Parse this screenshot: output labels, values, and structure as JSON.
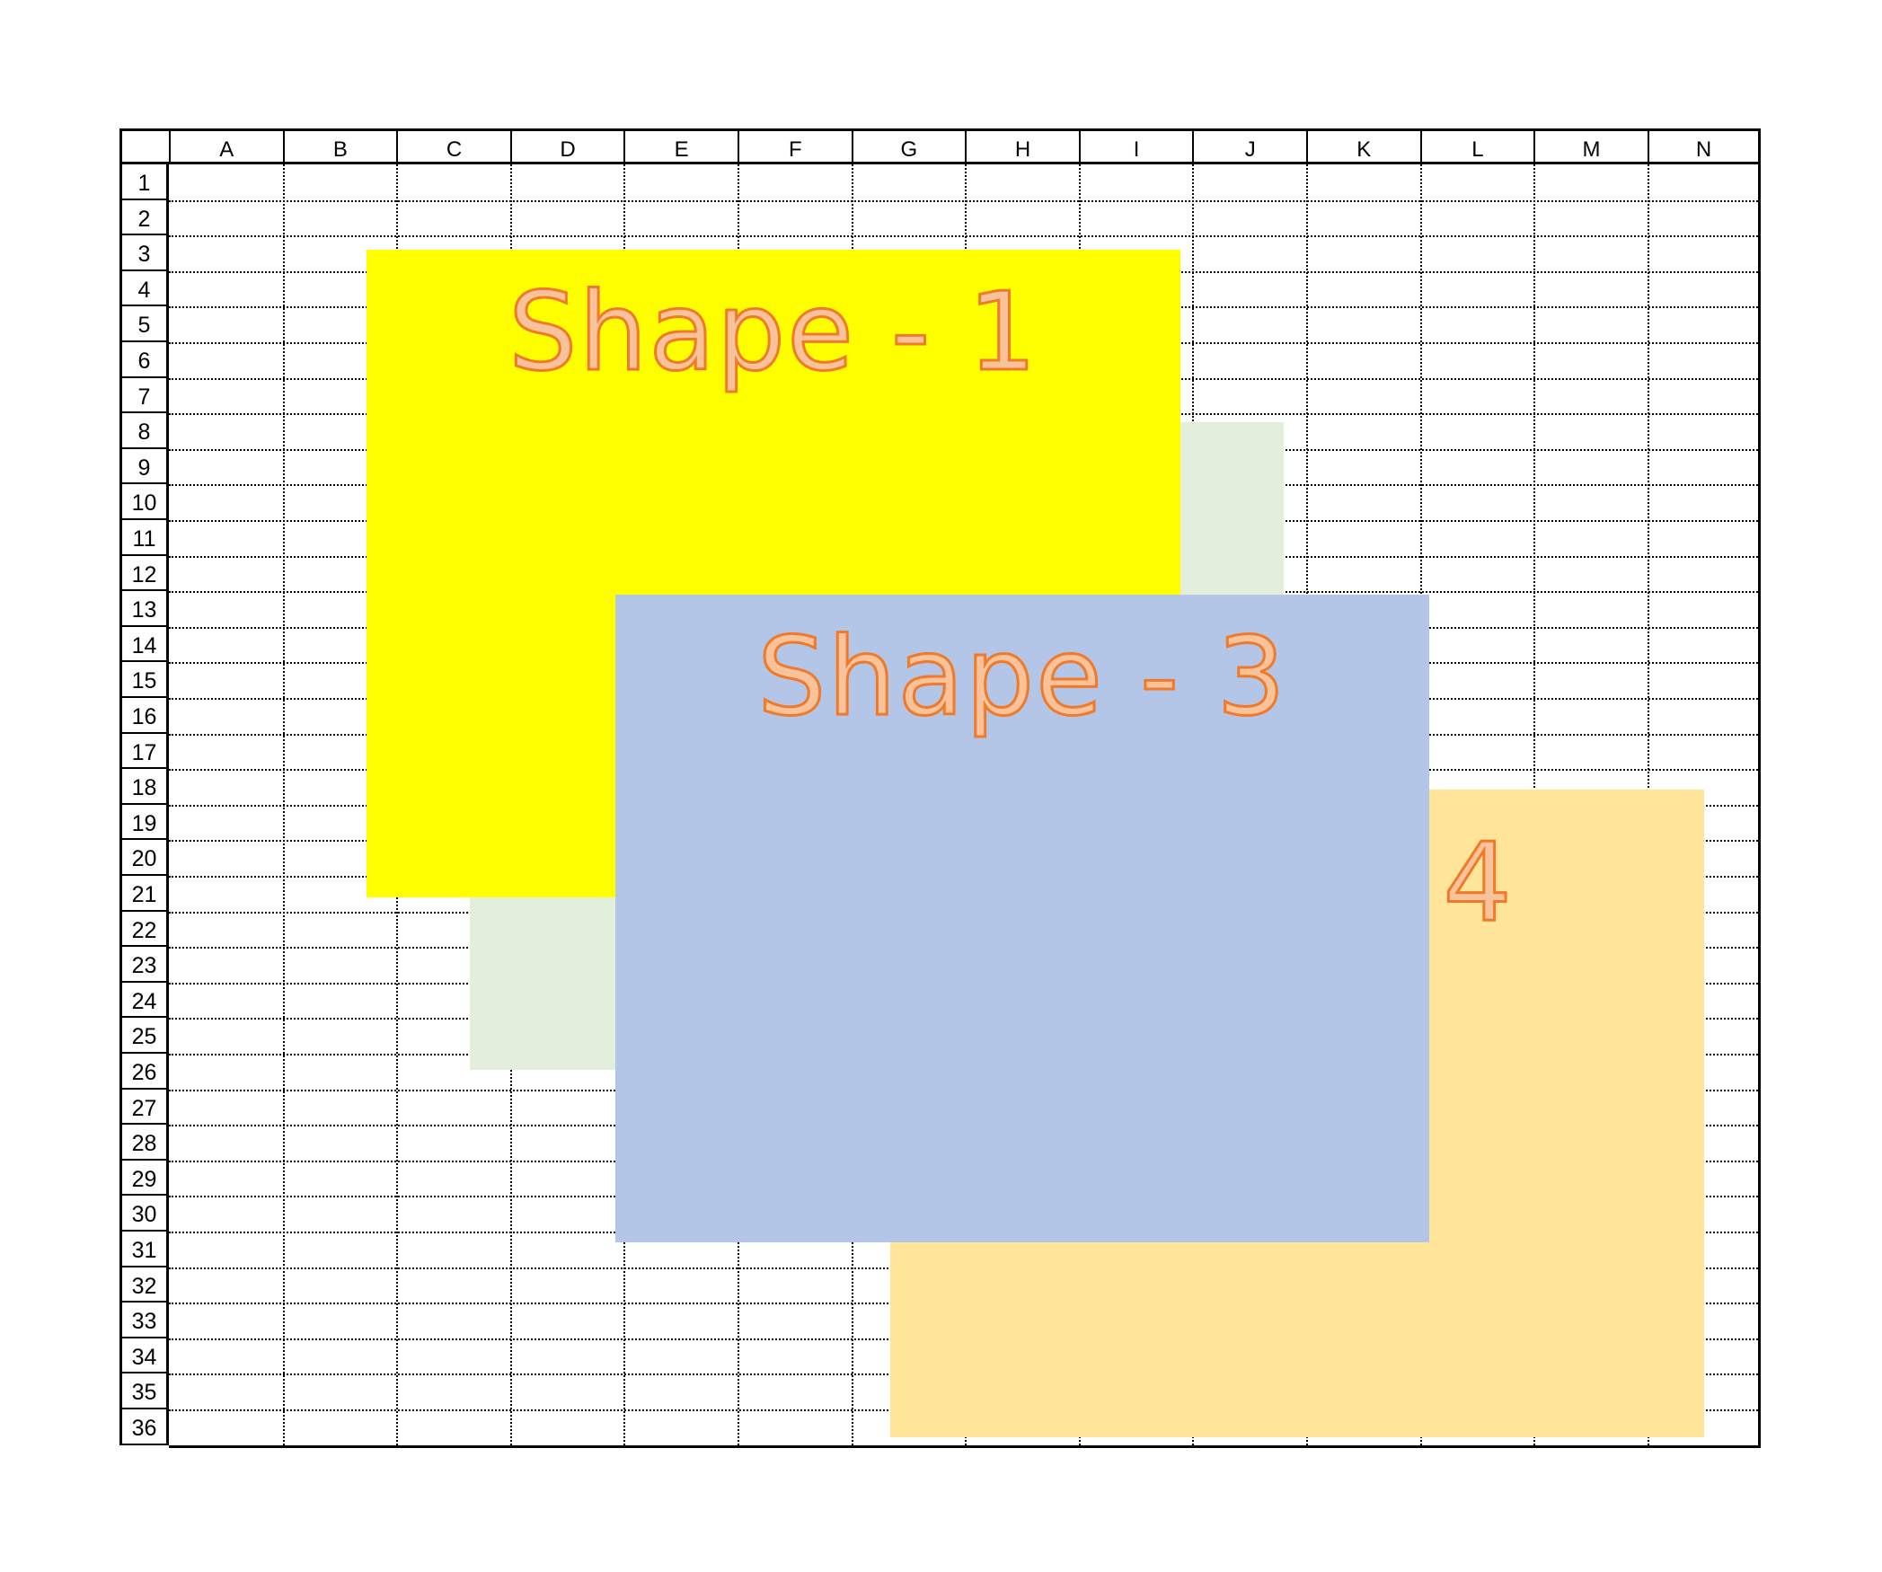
{
  "sheet": {
    "columns": [
      "A",
      "B",
      "C",
      "D",
      "E",
      "F",
      "G",
      "H",
      "I",
      "J",
      "K",
      "L",
      "M",
      "N"
    ],
    "rows": [
      "1",
      "2",
      "3",
      "4",
      "5",
      "6",
      "7",
      "8",
      "9",
      "10",
      "11",
      "12",
      "13",
      "14",
      "15",
      "16",
      "17",
      "18",
      "19",
      "20",
      "21",
      "22",
      "23",
      "24",
      "25",
      "26",
      "27",
      "28",
      "29",
      "30",
      "31",
      "32",
      "33",
      "34",
      "35",
      "36"
    ]
  },
  "shapes": [
    {
      "id": "shape-1",
      "label": "Shape - 1",
      "fill": "#ffff00"
    },
    {
      "id": "shape-2",
      "label": "",
      "fill": "#e2efda"
    },
    {
      "id": "shape-3",
      "label": "Shape - 3",
      "fill": "#b4c6e7"
    },
    {
      "id": "shape-4",
      "label": "- 4",
      "fill": "#fee599"
    }
  ],
  "colors": {
    "label_fill": "#f8c29a",
    "label_outline": "#f07a2a",
    "grid": "#000000"
  }
}
